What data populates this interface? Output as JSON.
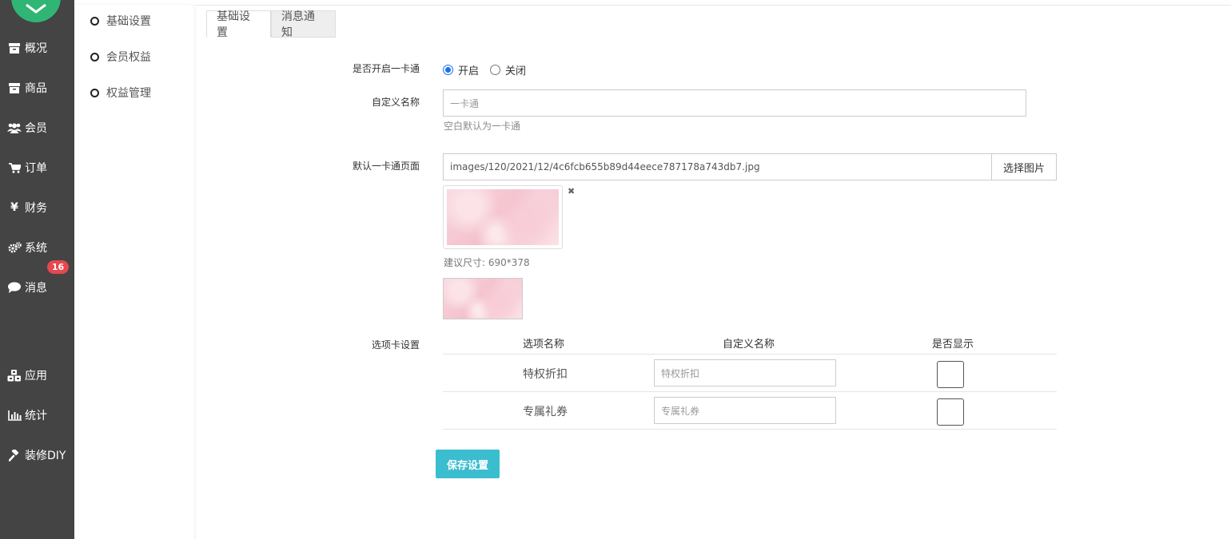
{
  "nav": {
    "items": [
      {
        "label": "概况",
        "icon": "archive-icon"
      },
      {
        "label": "商品",
        "icon": "archive-icon"
      },
      {
        "label": "会员",
        "icon": "users-icon"
      },
      {
        "label": "订单",
        "icon": "cart-icon"
      },
      {
        "label": "财务",
        "icon": "yen-icon"
      },
      {
        "label": "系统",
        "icon": "gears-icon"
      },
      {
        "label": "消息",
        "icon": "comment-icon",
        "badge": "16"
      },
      {
        "label": "应用",
        "icon": "cubes-icon"
      },
      {
        "label": "统计",
        "icon": "bar-chart-icon"
      },
      {
        "label": "装修DIY",
        "icon": "gavel-icon"
      }
    ]
  },
  "subnav": {
    "items": [
      "基础设置",
      "会员权益",
      "权益管理"
    ]
  },
  "tabs": [
    "基础设置",
    "消息通知"
  ],
  "form": {
    "enable_label": "是否开启一卡通",
    "radio_on": "开启",
    "radio_off": "关闭",
    "name_label": "自定义名称",
    "name_placeholder": "一卡通",
    "name_help": "空白默认为一卡通",
    "page_label": "默认一卡通页面",
    "page_value": "images/120/2021/12/4c6fcb655b89d44eece787178a743db7.jpg",
    "choose_button": "选择图片",
    "size_hint": "建议尺寸: 690*378",
    "tab_settings_label": "选项卡设置",
    "table": {
      "headers": [
        "选项名称",
        "自定义名称",
        "是否显示"
      ],
      "rows": [
        {
          "name": "特权折扣",
          "placeholder": "特权折扣"
        },
        {
          "name": "专属礼券",
          "placeholder": "专属礼券"
        }
      ]
    },
    "save_button": "保存设置"
  }
}
